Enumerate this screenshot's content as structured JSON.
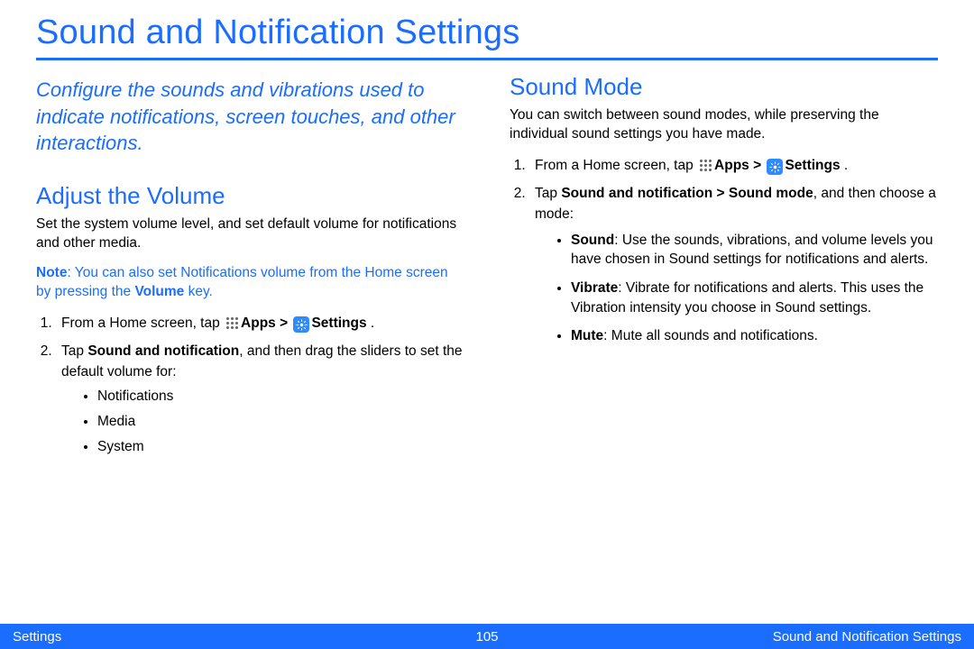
{
  "title": "Sound and Notification Settings",
  "intro": "Configure the sounds and vibrations used to indicate notifications, screen touches, and other interactions.",
  "left": {
    "heading": "Adjust the Volume",
    "desc": "Set the system volume level, and set default volume for notifications and other media.",
    "note_lead": "Note",
    "note_body": ": You can also set Notifications volume from the Home screen by pressing the ",
    "note_bold": "Volume",
    "note_tail": " key.",
    "step1_a": "From a Home screen, tap ",
    "step1_apps": "Apps",
    "step1_b": " > ",
    "step1_settings": "Settings",
    "step1_c": " .",
    "step2_a": "Tap ",
    "step2_bold": "Sound and notification",
    "step2_b": ", and then drag the sliders to set the default volume for:",
    "bullets": [
      "Notifications",
      "Media",
      "System"
    ]
  },
  "right": {
    "heading": "Sound Mode",
    "desc": "You can switch between sound modes, while preserving the individual sound settings you have made.",
    "step1_a": "From a Home screen, tap ",
    "step1_apps": "Apps",
    "step1_b": " > ",
    "step1_settings": "Settings",
    "step1_c": " .",
    "step2_a": "Tap ",
    "step2_bold": "Sound and notification > Sound mode",
    "step2_b": ", and then choose a mode:",
    "modes": [
      {
        "name": "Sound",
        "text": ": Use the sounds, vibrations, and volume levels you have chosen in Sound settings for notifications and alerts."
      },
      {
        "name": "Vibrate",
        "text": ": Vibrate for notifications and alerts. This uses the Vibration intensity you choose in Sound settings."
      },
      {
        "name": "Mute",
        "text": ": Mute all sounds and notifications."
      }
    ]
  },
  "footer": {
    "left": "Settings",
    "page": "105",
    "right": "Sound and Notification Settings"
  }
}
